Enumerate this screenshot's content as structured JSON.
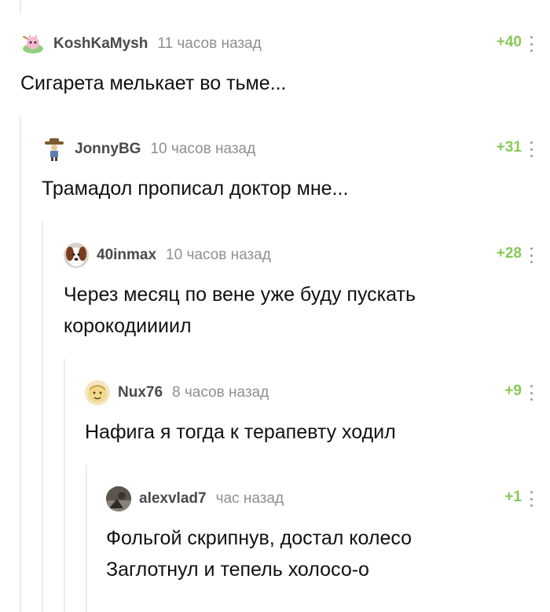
{
  "comments": [
    {
      "author": "KoshKaMysh",
      "time": "11 часов назад",
      "rating": "+40",
      "avatar_icon": "cat-mouse-avatar",
      "text_lines": [
        "Сигарета мелькает во тьме..."
      ]
    },
    {
      "author": "JonnyBG",
      "time": "10 часов назад",
      "rating": "+31",
      "avatar_icon": "cowboy-avatar",
      "text_lines": [
        "Трамадол прописал доктор мне..."
      ]
    },
    {
      "author": "40inmax",
      "time": "10 часов назад",
      "rating": "+28",
      "avatar_icon": "dog-avatar",
      "text_lines": [
        "Через месяц по вене уже буду пускать",
        "корокодиииил"
      ]
    },
    {
      "author": "Nux76",
      "time": "8 часов назад",
      "rating": "+9",
      "avatar_icon": "cartoon-face-avatar",
      "text_lines": [
        "Нафига я тогда к терапевту ходил"
      ]
    },
    {
      "author": "alexvlad7",
      "time": "час назад",
      "rating": "+1",
      "avatar_icon": "photo-avatar",
      "text_lines": [
        "Фольгой скрипнув, достал колесо",
        "Заглотнул и тепель холосо-о"
      ]
    }
  ],
  "colors": {
    "rating": "#8ac858",
    "author": "#4a4a4a",
    "time": "#8f8f8f",
    "thread_line": "#ececec"
  }
}
